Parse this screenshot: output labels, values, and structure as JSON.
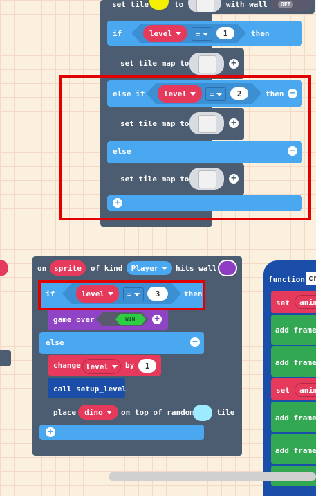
{
  "block1": {
    "set_tile": "set tile",
    "to": "to",
    "with_wall": "with wall",
    "toggle": "OFF",
    "if": "if",
    "var": "level",
    "op": "=",
    "val1": "1",
    "then": "then",
    "set_tilemap": "set tile map to",
    "else_if": "else if",
    "val2": "2",
    "else": "else"
  },
  "block2": {
    "on": "on",
    "sprite": "sprite",
    "of_kind": "of kind",
    "kind": "Player",
    "hits_wall": "hits wall",
    "if": "if",
    "var": "level",
    "op": "=",
    "val": "3",
    "then": "then",
    "game_over": "game over",
    "win": "WIN",
    "else": "else",
    "change": "change",
    "change_var": "level",
    "by": "by",
    "by_val": "1",
    "call": "call setup_level",
    "place": "place",
    "place_sprite": "dino",
    "on_top": "on top of random",
    "tile": "tile"
  },
  "block3": {
    "function": "function",
    "func_name": "cr",
    "set": "set",
    "anim": "anim",
    "add_frame": "add frame",
    "partial": "h anim"
  },
  "colors": {
    "event": "#4c5c71",
    "logic": "#4aa8f0",
    "variable": "#e53a5c",
    "game": "#8e44c4",
    "functions": "#1a4ea8",
    "animation": "#33a853",
    "highlight": "#e00000"
  }
}
